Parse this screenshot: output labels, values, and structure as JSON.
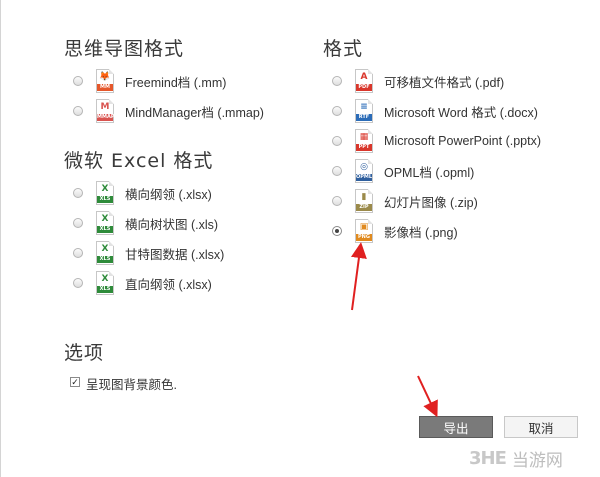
{
  "mindmap_section": {
    "title": "思维导图格式",
    "options": [
      {
        "label": "Freemind档 (.mm)",
        "icon": "freemind-file-icon",
        "tag": "MM",
        "color": "#e5572b",
        "glyph": "🦊",
        "checked": false
      },
      {
        "label": "MindManager档 (.mmap)",
        "icon": "mindmanager-file-icon",
        "tag": "MMAP",
        "color": "#d9534f",
        "glyph": "M",
        "checked": false
      }
    ]
  },
  "excel_section": {
    "title": "微软 Excel 格式",
    "options": [
      {
        "label": "横向纲领 (.xlsx)",
        "icon": "excel-file-icon",
        "tag": "XLS",
        "color": "#2e8b3a",
        "glyph": "X",
        "checked": false
      },
      {
        "label": "横向树状图 (.xls)",
        "icon": "excel-file-icon",
        "tag": "XLS",
        "color": "#2e8b3a",
        "glyph": "X",
        "checked": false
      },
      {
        "label": "甘特图数据 (.xlsx)",
        "icon": "excel-file-icon",
        "tag": "XLS",
        "color": "#2e8b3a",
        "glyph": "X",
        "checked": false
      },
      {
        "label": "直向纲领 (.xlsx)",
        "icon": "excel-file-icon",
        "tag": "XLS",
        "color": "#2e8b3a",
        "glyph": "X",
        "checked": false
      }
    ]
  },
  "format_section": {
    "title": "格式",
    "options": [
      {
        "label": "可移植文件格式 (.pdf)",
        "icon": "pdf-file-icon",
        "tag": "PDF",
        "color": "#d9362b",
        "glyph": "A",
        "checked": false
      },
      {
        "label": "Microsoft Word 格式 (.docx)",
        "icon": "word-file-icon",
        "tag": "RTF",
        "color": "#2b6cb8",
        "glyph": "≡",
        "checked": false
      },
      {
        "label": "Microsoft PowerPoint (.pptx)",
        "icon": "powerpoint-file-icon",
        "tag": "PPT",
        "color": "#d9362b",
        "glyph": "▦",
        "checked": false
      },
      {
        "label": "OPML档 (.opml)",
        "icon": "opml-file-icon",
        "tag": "OPML",
        "color": "#2f5f9e",
        "glyph": "◎",
        "checked": false
      },
      {
        "label": "幻灯片图像 (.zip)",
        "icon": "zip-file-icon",
        "tag": "ZIP",
        "color": "#9b8a4a",
        "glyph": "▮",
        "checked": false
      },
      {
        "label": "影像档 (.png)",
        "icon": "png-file-icon",
        "tag": "PNG",
        "color": "#e08a1e",
        "glyph": "▣",
        "checked": true
      }
    ]
  },
  "options_section": {
    "title": "选项",
    "checkbox_label": "呈现图背景颜色.",
    "checkbox_checked": true
  },
  "buttons": {
    "export": "导出",
    "cancel": "取消"
  },
  "watermark": {
    "logo": "3HE",
    "text": "当游网"
  }
}
